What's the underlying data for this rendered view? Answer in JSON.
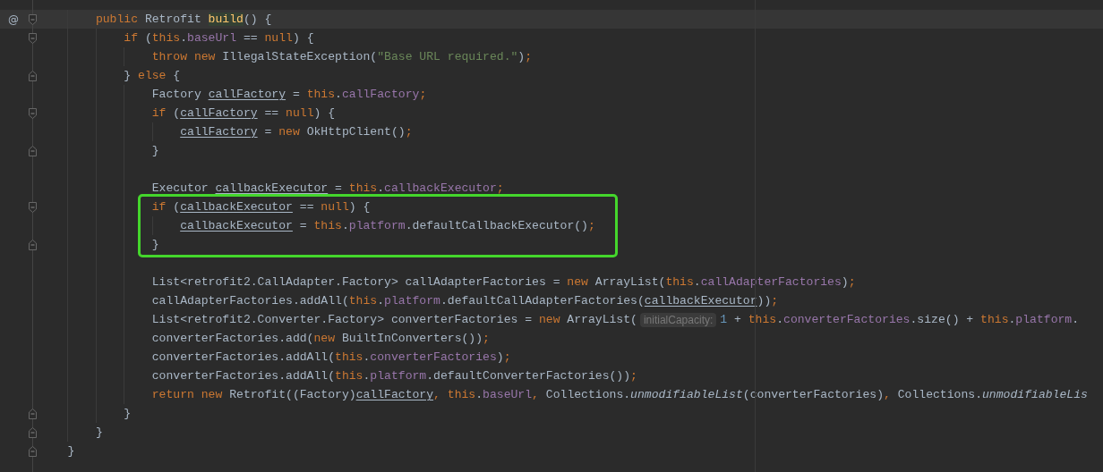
{
  "lines": [
    {
      "kind": "code",
      "current": true,
      "gutter_mark": "@",
      "fold_start": true,
      "fold_end": false,
      "tokens": [
        {
          "text": "        public ",
          "kind": "keyword"
        },
        {
          "text": "Retrofit ",
          "kind": "plain"
        },
        {
          "text": "build",
          "kind": "decl"
        },
        {
          "text": "() {",
          "kind": "plain"
        }
      ]
    },
    {
      "kind": "code",
      "fold_start": true,
      "fold_end": false,
      "tokens": [
        {
          "text": "            if ",
          "kind": "keyword"
        },
        {
          "text": "(",
          "kind": "plain"
        },
        {
          "text": "this",
          "kind": "keyword"
        },
        {
          "text": ".",
          "kind": "plain"
        },
        {
          "text": "baseUrl",
          "kind": "field"
        },
        {
          "text": " == ",
          "kind": "plain"
        },
        {
          "text": "null",
          "kind": "keyword"
        },
        {
          "text": ") {",
          "kind": "plain"
        }
      ]
    },
    {
      "kind": "code",
      "tokens": [
        {
          "text": "                throw new ",
          "kind": "keyword"
        },
        {
          "text": "IllegalStateException(",
          "kind": "plain"
        },
        {
          "text": "\"Base URL required.\"",
          "kind": "string"
        },
        {
          "text": ")",
          "kind": "plain"
        },
        {
          "text": ";",
          "kind": "keyword"
        }
      ]
    },
    {
      "kind": "code",
      "fold_start": false,
      "fold_end": true,
      "tokens": [
        {
          "text": "            } ",
          "kind": "plain"
        },
        {
          "text": "else",
          "kind": "keyword"
        },
        {
          "text": " {",
          "kind": "plain"
        }
      ]
    },
    {
      "kind": "code",
      "tokens": [
        {
          "text": "                Factory ",
          "kind": "plain"
        },
        {
          "text": "callFactory",
          "kind": "var"
        },
        {
          "text": " = ",
          "kind": "plain"
        },
        {
          "text": "this",
          "kind": "keyword"
        },
        {
          "text": ".",
          "kind": "plain"
        },
        {
          "text": "callFactory",
          "kind": "field"
        },
        {
          "text": ";",
          "kind": "keyword"
        }
      ]
    },
    {
      "kind": "code",
      "fold_start": true,
      "fold_end": false,
      "tokens": [
        {
          "text": "                if ",
          "kind": "keyword"
        },
        {
          "text": "(",
          "kind": "plain"
        },
        {
          "text": "callFactory",
          "kind": "var"
        },
        {
          "text": " == ",
          "kind": "plain"
        },
        {
          "text": "null",
          "kind": "keyword"
        },
        {
          "text": ") {",
          "kind": "plain"
        }
      ]
    },
    {
      "kind": "code",
      "tokens": [
        {
          "text": "                    callFactory",
          "kind": "var"
        },
        {
          "text": " = ",
          "kind": "plain"
        },
        {
          "text": "new ",
          "kind": "keyword"
        },
        {
          "text": "OkHttpClient()",
          "kind": "plain"
        },
        {
          "text": ";",
          "kind": "keyword"
        }
      ]
    },
    {
      "kind": "code",
      "fold_start": false,
      "fold_end": true,
      "tokens": [
        {
          "text": "                }",
          "kind": "plain"
        }
      ]
    },
    {
      "kind": "blank"
    },
    {
      "kind": "code",
      "tokens": [
        {
          "text": "                Executor ",
          "kind": "plain"
        },
        {
          "text": "callbackExecutor",
          "kind": "var"
        },
        {
          "text": " = ",
          "kind": "plain"
        },
        {
          "text": "this",
          "kind": "keyword"
        },
        {
          "text": ".",
          "kind": "plain"
        },
        {
          "text": "callbackExecutor",
          "kind": "field"
        },
        {
          "text": ";",
          "kind": "keyword"
        }
      ]
    },
    {
      "kind": "code",
      "boxed": true,
      "fold_start": true,
      "fold_end": false,
      "tokens": [
        {
          "text": "                if ",
          "kind": "keyword"
        },
        {
          "text": "(",
          "kind": "plain"
        },
        {
          "text": "callbackExecutor",
          "kind": "var"
        },
        {
          "text": " == ",
          "kind": "plain"
        },
        {
          "text": "null",
          "kind": "keyword"
        },
        {
          "text": ") {",
          "kind": "plain"
        }
      ]
    },
    {
      "kind": "code",
      "boxed": true,
      "tokens": [
        {
          "text": "                    callbackExecutor",
          "kind": "var"
        },
        {
          "text": " = ",
          "kind": "plain"
        },
        {
          "text": "this",
          "kind": "keyword"
        },
        {
          "text": ".",
          "kind": "plain"
        },
        {
          "text": "platform",
          "kind": "field"
        },
        {
          "text": ".defaultCallbackExecutor()",
          "kind": "plain"
        },
        {
          "text": ";",
          "kind": "keyword"
        }
      ]
    },
    {
      "kind": "code",
      "boxed": true,
      "fold_start": false,
      "fold_end": true,
      "tokens": [
        {
          "text": "                }",
          "kind": "plain"
        }
      ]
    },
    {
      "kind": "blank"
    },
    {
      "kind": "code",
      "tokens": [
        {
          "text": "                List<retrofit2.CallAdapter.Factory> callAdapterFactories = ",
          "kind": "plain"
        },
        {
          "text": "new ",
          "kind": "keyword"
        },
        {
          "text": "ArrayList(",
          "kind": "plain"
        },
        {
          "text": "this",
          "kind": "keyword"
        },
        {
          "text": ".",
          "kind": "plain"
        },
        {
          "text": "callAdapterFactories",
          "kind": "field"
        },
        {
          "text": ")",
          "kind": "plain"
        },
        {
          "text": ";",
          "kind": "keyword"
        }
      ]
    },
    {
      "kind": "code",
      "tokens": [
        {
          "text": "                callAdapterFactories.addAll(",
          "kind": "plain"
        },
        {
          "text": "this",
          "kind": "keyword"
        },
        {
          "text": ".",
          "kind": "plain"
        },
        {
          "text": "platform",
          "kind": "field"
        },
        {
          "text": ".defaultCallAdapterFactories(",
          "kind": "plain"
        },
        {
          "text": "callbackExecutor",
          "kind": "var"
        },
        {
          "text": "))",
          "kind": "plain"
        },
        {
          "text": ";",
          "kind": "keyword"
        }
      ]
    },
    {
      "kind": "code",
      "tokens": [
        {
          "text": "                List<retrofit2.Converter.Factory> converterFactories = ",
          "kind": "plain"
        },
        {
          "text": "new ",
          "kind": "keyword"
        },
        {
          "text": "ArrayList(",
          "kind": "plain"
        },
        {
          "text": "initialCapacity:",
          "kind": "hint"
        },
        {
          "text": "1",
          "kind": "number"
        },
        {
          "text": " + ",
          "kind": "plain"
        },
        {
          "text": "this",
          "kind": "keyword"
        },
        {
          "text": ".",
          "kind": "plain"
        },
        {
          "text": "converterFactories",
          "kind": "field"
        },
        {
          "text": ".size() + ",
          "kind": "plain"
        },
        {
          "text": "this",
          "kind": "keyword"
        },
        {
          "text": ".",
          "kind": "plain"
        },
        {
          "text": "platform",
          "kind": "field"
        },
        {
          "text": ".",
          "kind": "plain"
        }
      ]
    },
    {
      "kind": "code",
      "tokens": [
        {
          "text": "                converterFactories.add(",
          "kind": "plain"
        },
        {
          "text": "new ",
          "kind": "keyword"
        },
        {
          "text": "BuiltInConverters())",
          "kind": "plain"
        },
        {
          "text": ";",
          "kind": "keyword"
        }
      ]
    },
    {
      "kind": "code",
      "tokens": [
        {
          "text": "                converterFactories.addAll(",
          "kind": "plain"
        },
        {
          "text": "this",
          "kind": "keyword"
        },
        {
          "text": ".",
          "kind": "plain"
        },
        {
          "text": "converterFactories",
          "kind": "field"
        },
        {
          "text": ")",
          "kind": "plain"
        },
        {
          "text": ";",
          "kind": "keyword"
        }
      ]
    },
    {
      "kind": "code",
      "tokens": [
        {
          "text": "                converterFactories.addAll(",
          "kind": "plain"
        },
        {
          "text": "this",
          "kind": "keyword"
        },
        {
          "text": ".",
          "kind": "plain"
        },
        {
          "text": "platform",
          "kind": "field"
        },
        {
          "text": ".defaultConverterFactories())",
          "kind": "plain"
        },
        {
          "text": ";",
          "kind": "keyword"
        }
      ]
    },
    {
      "kind": "code",
      "tokens": [
        {
          "text": "                return new ",
          "kind": "keyword"
        },
        {
          "text": "Retrofit((Factory)",
          "kind": "plain"
        },
        {
          "text": "callFactory",
          "kind": "var"
        },
        {
          "text": ", ",
          "kind": "keyword"
        },
        {
          "text": "this",
          "kind": "keyword"
        },
        {
          "text": ".",
          "kind": "plain"
        },
        {
          "text": "baseUrl",
          "kind": "field"
        },
        {
          "text": ", ",
          "kind": "keyword"
        },
        {
          "text": "Collections.",
          "kind": "plain"
        },
        {
          "text": "unmodifiableList",
          "kind": "static"
        },
        {
          "text": "(converterFactories)",
          "kind": "plain"
        },
        {
          "text": ", ",
          "kind": "keyword"
        },
        {
          "text": "Collections.",
          "kind": "plain"
        },
        {
          "text": "unmodifiableLis",
          "kind": "static"
        }
      ]
    },
    {
      "kind": "code",
      "fold_start": false,
      "fold_end": true,
      "tokens": [
        {
          "text": "            }",
          "kind": "plain"
        }
      ]
    },
    {
      "kind": "code",
      "fold_start": false,
      "fold_end": true,
      "tokens": [
        {
          "text": "        }",
          "kind": "plain"
        }
      ]
    },
    {
      "kind": "code",
      "fold_start": false,
      "fold_end": true,
      "tokens": [
        {
          "text": "    }",
          "kind": "plain"
        }
      ]
    }
  ]
}
